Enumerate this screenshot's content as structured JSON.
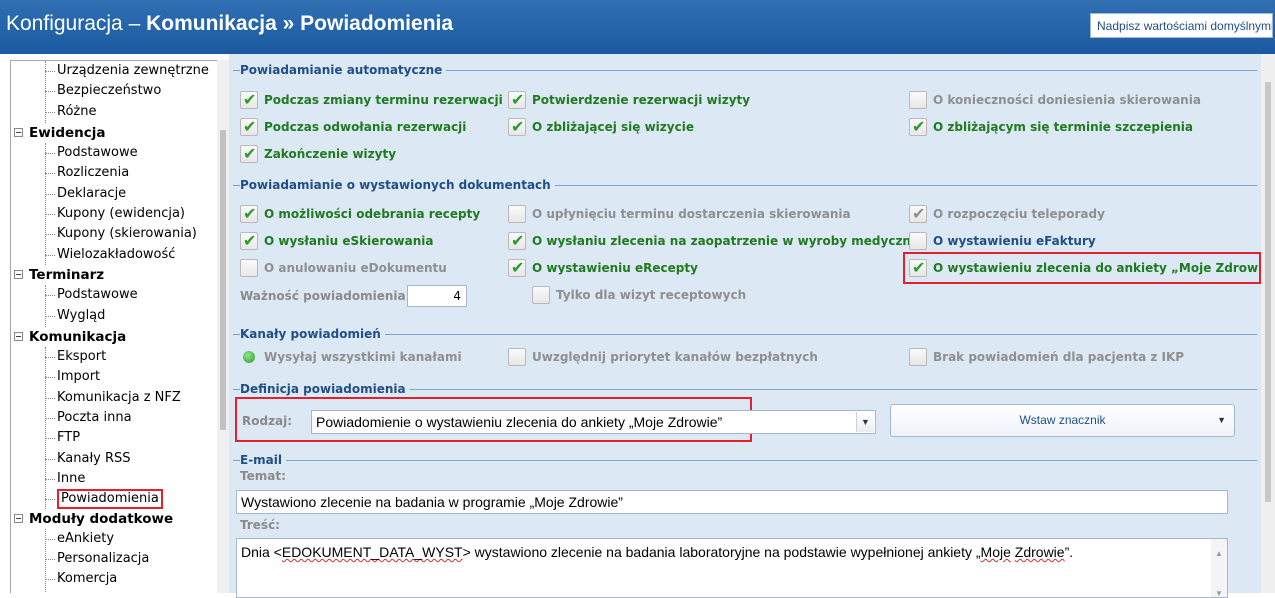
{
  "header": {
    "title_prefix": "Konfiguracja – ",
    "title_section": "Komunikacja",
    "title_separator": " » ",
    "title_page": "Powiadomienia",
    "reset_button": "Nadpisz wartościami domyślnymi"
  },
  "tree": {
    "items": [
      {
        "type": "child",
        "label": "Urządzenia zewnętrzne"
      },
      {
        "type": "child",
        "label": "Bezpieczeństwo"
      },
      {
        "type": "child",
        "label": "Różne"
      },
      {
        "type": "group",
        "label": "Ewidencja",
        "expander": "−"
      },
      {
        "type": "child",
        "label": "Podstawowe"
      },
      {
        "type": "child",
        "label": "Rozliczenia"
      },
      {
        "type": "child",
        "label": "Deklaracje"
      },
      {
        "type": "child",
        "label": "Kupony (ewidencja)"
      },
      {
        "type": "child",
        "label": "Kupony (skierowania)"
      },
      {
        "type": "child",
        "label": "Wielozakładowość"
      },
      {
        "type": "group",
        "label": "Terminarz",
        "expander": "−"
      },
      {
        "type": "child",
        "label": "Podstawowe"
      },
      {
        "type": "child",
        "label": "Wygląd"
      },
      {
        "type": "group",
        "label": "Komunikacja",
        "expander": "−"
      },
      {
        "type": "child",
        "label": "Eksport"
      },
      {
        "type": "child",
        "label": "Import"
      },
      {
        "type": "child",
        "label": "Komunikacja z NFZ"
      },
      {
        "type": "child",
        "label": "Poczta inna"
      },
      {
        "type": "child",
        "label": "FTP"
      },
      {
        "type": "child",
        "label": "Kanały RSS"
      },
      {
        "type": "child",
        "label": "Inne"
      },
      {
        "type": "child",
        "label": "Powiadomienia",
        "selected": true
      },
      {
        "type": "group",
        "label": "Moduły dodatkowe",
        "expander": "−"
      },
      {
        "type": "child",
        "label": "eAnkiety"
      },
      {
        "type": "child",
        "label": "Personalizacja"
      },
      {
        "type": "child",
        "label": "Komercja"
      }
    ]
  },
  "sections": {
    "auto": "Powiadamianie automatyczne",
    "docs": "Powiadamianie o wystawionych dokumentach",
    "channels": "Kanały powiadomień",
    "definition": "Definicja powiadomienia",
    "email": "E-mail"
  },
  "auto_checks": {
    "c1": "Podczas zmiany terminu rezerwacji",
    "c2": "Potwierdzenie rezerwacji wizyty",
    "c3": "O konieczności doniesienia skierowania",
    "c4": "Podczas odwołania rezerwacji",
    "c5": "O zbliżającej się wizycie",
    "c6": "O zbliżającym się terminie szczepienia",
    "c7": "Zakończenie wizyty"
  },
  "doc_checks": {
    "d1": "O możliwości odebrania recepty",
    "d2": "O upłynięciu terminu dostarczenia skierowania",
    "d3": "O rozpoczęciu teleporady",
    "d4": "O wysłaniu eSkierowania",
    "d5": "O wysłaniu zlecenia na zaopatrzenie w wyroby medyczne",
    "d6": "O wystawieniu eFaktury",
    "d7": "O anulowaniu eDokumentu",
    "d8": "O wystawieniu eRecepty",
    "d9": "O wystawieniu zlecenia do ankiety „Moje Zdrowie”",
    "validity_label": "Ważność powiadomienia:",
    "validity_value": "4",
    "only_rx": "Tylko dla wizyt receptowych"
  },
  "channel_opts": {
    "all": "Wysyłaj wszystkimi kanałami",
    "priority": "Uwzględnij priorytet kanałów bezpłatnych",
    "ikp": "Brak powiadomień dla pacjenta z IKP"
  },
  "definition": {
    "type_label": "Rodzaj:",
    "type_value": "Powiadomienie o wystawieniu zlecenia do ankiety „Moje Zdrowie”",
    "insert_tag": "Wstaw znacznik"
  },
  "email": {
    "subject_label": "Temat:",
    "subject_value": "Wystawiono zlecenie na badania w programie „Moje Zdrowie”",
    "body_label": "Treść:",
    "body_part1": "Dnia <",
    "body_tag": "EDOKUMENT_DATA_WYST",
    "body_part2": "> wystawiono zlecenie na badania laboratoryjne na podstawie wypełnionej ankiety „",
    "body_moje": "Moje",
    "body_space": " ",
    "body_zdrowie": "Zdrowie",
    "body_part3": "”."
  },
  "colors": {
    "header_bg": "#1b5aa0",
    "panel_bg": "#dde8f5",
    "checked_text": "#207a20",
    "highlight": "#e4202a"
  }
}
